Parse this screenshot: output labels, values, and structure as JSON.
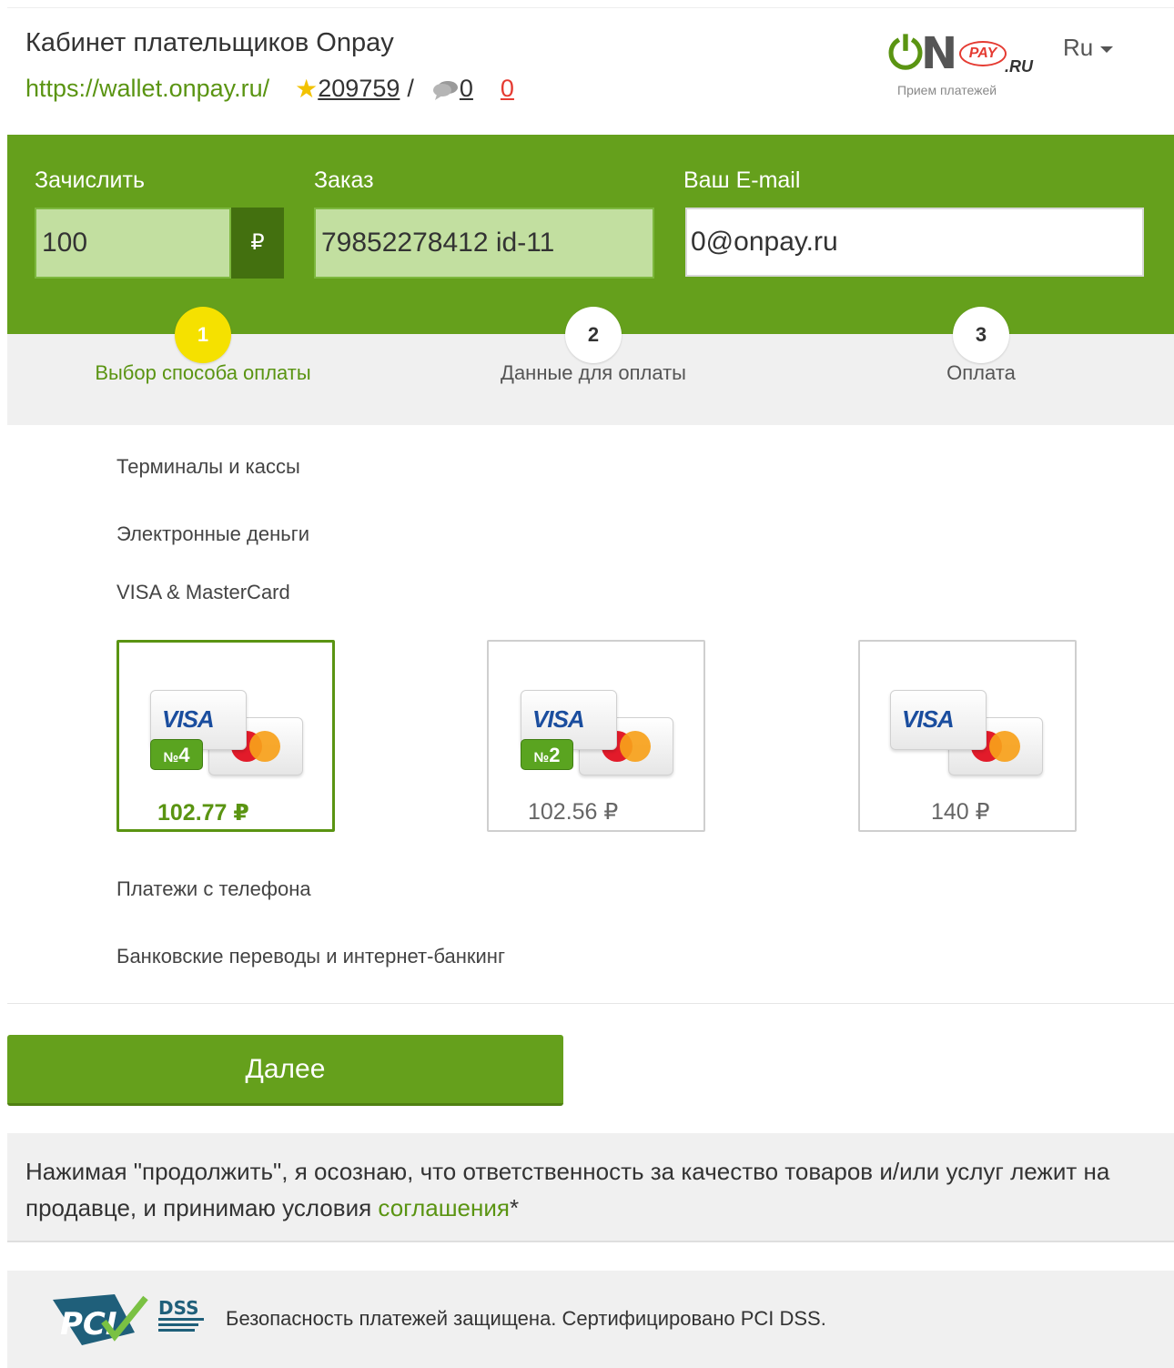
{
  "header": {
    "title": "Кабинет плательщиков Onpay",
    "url": "https://wallet.onpay.ru/",
    "rating": "209759",
    "separator": "/",
    "messages": "0",
    "alerts": "0",
    "logo": {
      "main": "N",
      "pay": "PAY",
      "ru": ".RU",
      "subtitle": "Прием платежей"
    },
    "language": "Ru"
  },
  "form": {
    "amount_label": "Зачислить",
    "amount_value": "100",
    "currency_symbol": "₽",
    "order_label": "Заказ",
    "order_value": "79852278412 id-11",
    "email_label": "Ваш E-mail",
    "email_value": "0@onpay.ru"
  },
  "steps": [
    {
      "num": "1",
      "label": "Выбор способа оплаты"
    },
    {
      "num": "2",
      "label": "Данные для оплаты"
    },
    {
      "num": "3",
      "label": "Оплата"
    }
  ],
  "sections": {
    "terminals": "Терминалы и кассы",
    "emoney": "Электронные деньги",
    "cards": "VISA & MasterCard",
    "phone": "Платежи с телефона",
    "bank": "Банковские переводы и интернет-банкинг"
  },
  "card_options": [
    {
      "brand": "VISA",
      "badge": "4",
      "price": "102.77 ₽",
      "selected": true
    },
    {
      "brand": "VISA",
      "badge": "2",
      "price": "102.56 ₽",
      "selected": false
    },
    {
      "brand": "VISA",
      "badge": "",
      "price": "140 ₽",
      "selected": false
    }
  ],
  "next_button": "Далее",
  "notice": {
    "text": "Нажимая \"продолжить\", я осознаю, что ответственность за качество товаров и/или услуг лежит на продавце, и принимаю условия ",
    "link": "соглашения",
    "suffix": "*"
  },
  "footer": {
    "pci_logo": "PCI",
    "pci_dss": "DSS",
    "text": "Безопасность платежей защищена. Сертифицировано PCI DSS."
  },
  "colors": {
    "brand_green": "#65a01c",
    "dark_green": "#43700f",
    "step_active": "#f5e100",
    "alert_red": "#e53b32"
  }
}
